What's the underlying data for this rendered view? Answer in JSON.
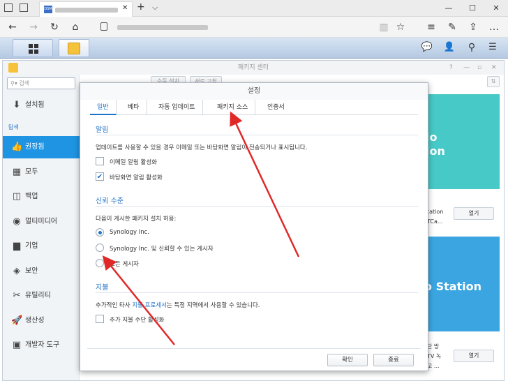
{
  "browser": {
    "tab_favicon": "DSM",
    "tab_close": "✕",
    "new_tab": "+",
    "tab_menu": "⌵",
    "win_min": "—",
    "win_max": "☐",
    "win_close": "✕",
    "nav": {
      "back": "←",
      "forward": "→",
      "refresh": "↻",
      "home": "⌂",
      "lock": "🔒"
    },
    "toolbar": {
      "reading": "▥",
      "favorite": "☆",
      "hub": "≡",
      "notes": "✎",
      "share": "⇪",
      "more": "…"
    }
  },
  "dsm": {
    "main_menu_icon": "grid-icon",
    "taskbar": {
      "chat": "💬",
      "user": "👤",
      "search": "⚲",
      "widgets": "☰"
    }
  },
  "package_center": {
    "title": "패키지 센터",
    "header_controls": [
      "?",
      "—",
      "▫",
      "✕"
    ],
    "search_placeholder": "검색",
    "buttons": [
      "수동 설치",
      "새로 고침"
    ],
    "sort_icon": "⇅",
    "sidebar": {
      "installed": "설치됨",
      "browse_heading": "탐색",
      "items": [
        {
          "label": "권장됨",
          "icon": "👍",
          "active": true
        },
        {
          "label": "모두",
          "icon": "▦"
        },
        {
          "label": "백업",
          "icon": "◫"
        },
        {
          "label": "멀티미디어",
          "icon": "◉"
        },
        {
          "label": "기업",
          "icon": "▆"
        },
        {
          "label": "보안",
          "icon": "◈"
        },
        {
          "label": "유틸리티",
          "icon": "✂"
        },
        {
          "label": "생산성",
          "icon": "🚀"
        },
        {
          "label": "개발자 도구",
          "icon": "▣"
        }
      ]
    },
    "cards": {
      "card1_title_lines": [
        "io",
        "ion"
      ],
      "card1_desc": [
        "tation",
        "TCa..."
      ],
      "card2_title": "o Station",
      "card2_desc": [
        "단 방",
        "TV 녹",
        "고 ..."
      ],
      "open_label": "열기"
    }
  },
  "dialog": {
    "title": "설정",
    "tabs": [
      "일반",
      "베타",
      "자동 업데이트",
      "패키지 소스",
      "인증서"
    ],
    "alerts": {
      "heading": "알림",
      "description": "업데이트를 사용할 수 있을 경우 이메일 또는 바탕화면 알림이 전송되거나 표시됩니다.",
      "email_label": "이메일 알림 활성화",
      "email_checked": false,
      "desktop_label": "바탕화면 알림 활성화",
      "desktop_checked": true
    },
    "trust": {
      "heading": "신뢰 수준",
      "description": "다음이 게시한 패키지 설치 허용:",
      "options": [
        "Synology Inc.",
        "Synology Inc. 및 신뢰할 수 있는 게시자",
        "모든 게시자"
      ],
      "selected": 0
    },
    "payment": {
      "heading": "지불",
      "description_pre": "추가적인 타사 ",
      "description_link": "지불 프로세서",
      "description_post": "는 특정 지역에서 사용할 수 있습니다.",
      "enable_label": "추가 지불 수단 활성화",
      "enable_checked": false
    },
    "ok_label": "확인",
    "cancel_label": "종료"
  },
  "colors": {
    "accent": "#1f73c9",
    "sidebar_active": "#1f94e3",
    "card_teal": "#46c9c7",
    "card_blue": "#3aa5e0",
    "arrow": "#e02828"
  }
}
